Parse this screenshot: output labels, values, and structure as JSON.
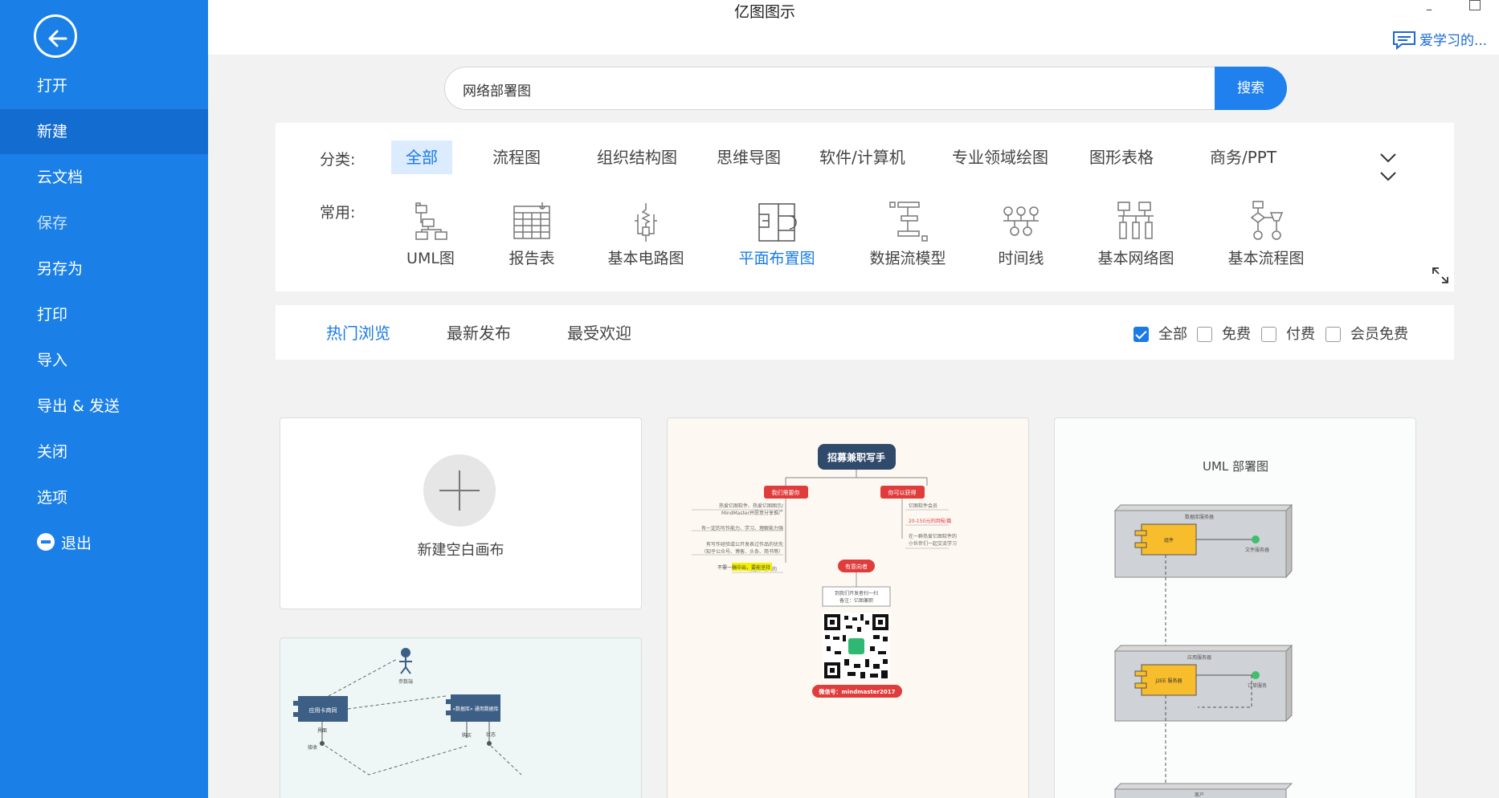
{
  "window": {
    "title": "亿图图示",
    "minimize": "–",
    "user_name": "爱学习的..."
  },
  "sidebar": {
    "items": [
      {
        "label": "打开"
      },
      {
        "label": "新建"
      },
      {
        "label": "云文档"
      },
      {
        "label": "保存"
      },
      {
        "label": "另存为"
      },
      {
        "label": "打印"
      },
      {
        "label": "导入"
      },
      {
        "label": "导出 & 发送"
      },
      {
        "label": "关闭"
      },
      {
        "label": "选项"
      },
      {
        "label": "退出"
      }
    ],
    "active_index": 1,
    "colors": {
      "background": "#1a80e8",
      "active": "#136cd0"
    }
  },
  "search": {
    "value": "网络部署图",
    "button_label": "搜索"
  },
  "categories": {
    "label": "分类:",
    "tabs": [
      "全部",
      "流程图",
      "组织结构图",
      "思维导图",
      "软件/计算机",
      "专业领域绘图",
      "图形表格",
      "商务/PPT"
    ],
    "active": "全部",
    "common_label": "常用:",
    "common": [
      {
        "label": "UML图",
        "icon": "uml-diagram-icon"
      },
      {
        "label": "报告表",
        "icon": "report-table-icon"
      },
      {
        "label": "基本电路图",
        "icon": "circuit-diagram-icon"
      },
      {
        "label": "平面布置图",
        "icon": "floor-plan-icon"
      },
      {
        "label": "数据流模型",
        "icon": "data-flow-icon"
      },
      {
        "label": "时间线",
        "icon": "timeline-icon"
      },
      {
        "label": "基本网络图",
        "icon": "network-diagram-icon"
      },
      {
        "label": "基本流程图",
        "icon": "flowchart-icon"
      }
    ],
    "common_active": "平面布置图"
  },
  "filter": {
    "tabs": [
      "热门浏览",
      "最新发布",
      "最受欢迎"
    ],
    "active_tab": "热门浏览",
    "checks": [
      {
        "label": "全部",
        "checked": true
      },
      {
        "label": "免费",
        "checked": false
      },
      {
        "label": "付费",
        "checked": false
      },
      {
        "label": "会员免费",
        "checked": false
      }
    ]
  },
  "cards": {
    "new_blank": "新建空白画布",
    "recruit": {
      "title": "招募兼职写手",
      "left_head": "我们需要你",
      "right_head": "你可以获得",
      "left_lines": [
        "热爱亿图软件、热爱亿图图示/",
        "MindMaster并愿意分享推广",
        "有一定的写作能力、学习、理解能力强",
        "有写作经验或公开发表过作品的优先",
        "（知乎公众号、博客、头条、简书等）",
        "不需一稿中出，要能坚持",
        "有空余时间的"
      ],
      "right_lines": [
        "亿图软件会员",
        "20-150元的回报/篇",
        "在一群热爱亿图软件的",
        "小伙伴们一起交流学习"
      ],
      "bottom_head": "有意向者",
      "bottom_lines": [
        "到我们开发者扫一扫",
        "备注：亿图兼职"
      ],
      "wechat": "微信号：mindmaster2017"
    },
    "uml": {
      "title": "UML 部署图",
      "node1": "数据库服务器",
      "comp1": "组件",
      "port1": "文件服务器",
      "node2": "应用服务器",
      "comp2": "J2EE 服务器",
      "port2": "订单服务",
      "node3": "客户"
    },
    "deploy": {
      "box1": "应用卡商同",
      "box2": "«数据库» 通用数据库",
      "actor": "参数端",
      "l1": "界面",
      "l2": "接收",
      "l3": "购买",
      "l4": "状态"
    }
  }
}
